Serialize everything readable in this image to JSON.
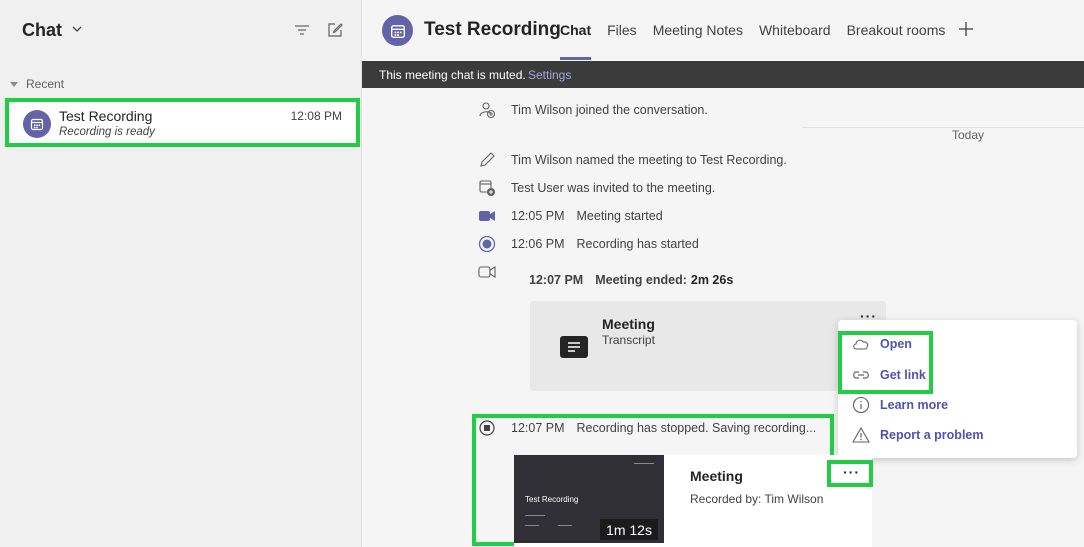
{
  "left": {
    "title": "Chat",
    "recent_label": "Recent",
    "chat_item": {
      "name": "Test Recording",
      "subtitle": "Recording is ready",
      "time": "12:08 PM"
    }
  },
  "header": {
    "title": "Test Recording",
    "tabs": [
      "Chat",
      "Files",
      "Meeting Notes",
      "Whiteboard",
      "Breakout rooms"
    ]
  },
  "muted_bar": {
    "text": "This meeting chat is muted.",
    "link": "Settings"
  },
  "messages": {
    "joined": "Tim Wilson joined the conversation.",
    "divider": "Today",
    "renamed": "Tim Wilson named the meeting to Test Recording.",
    "invited": "Test User was invited to the meeting.",
    "started_time": "12:05 PM",
    "started": "Meeting started",
    "rec_started_time": "12:06 PM",
    "rec_started": "Recording has started",
    "ended_time": "12:07 PM",
    "ended_label": "Meeting ended:",
    "ended_duration": "2m 26s",
    "stopped_time": "12:07 PM",
    "stopped": "Recording has stopped. Saving recording..."
  },
  "transcript_card": {
    "title": "Meeting",
    "subtitle": "Transcript",
    "more": "···"
  },
  "context_menu": {
    "items": [
      "Open",
      "Get link",
      "Learn more",
      "Report a problem"
    ]
  },
  "recording_card": {
    "thumb_title": "Test Recording",
    "duration": "1m 12s",
    "title": "Meeting",
    "subtitle": "Recorded by: Tim Wilson",
    "more": "···"
  },
  "colors": {
    "accent": "#6264a7",
    "highlight": "#22cc44",
    "menu_text": "#4f52b2"
  }
}
